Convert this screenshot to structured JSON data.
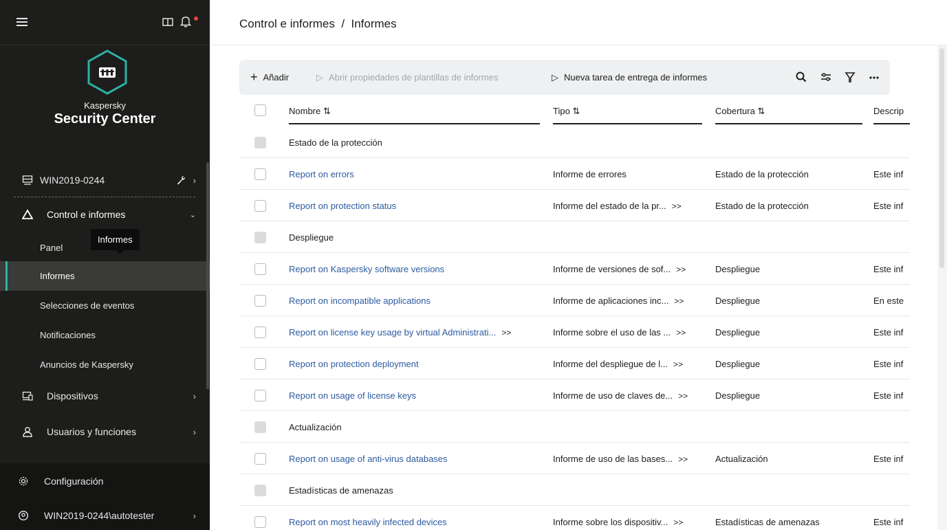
{
  "sidebar": {
    "brand_small": "Kaspersky",
    "brand_large": "Security Center",
    "server": "WIN2019-0244",
    "section": "Control e informes",
    "sub_items": [
      "Panel",
      "Informes",
      "Selecciones de eventos",
      "Notificaciones",
      "Anuncios de Kaspersky"
    ],
    "devices": "Dispositivos",
    "users": "Usuarios y funciones",
    "settings": "Configuración",
    "account": "WIN2019-0244\\autotester",
    "tooltip": "Informes",
    "accent": "#2cb3a6"
  },
  "header": {
    "breadcrumb": "Control e informes  /  Informes"
  },
  "toolbar": {
    "add": "Añadir",
    "open_props": "Abrir propiedades de plantillas de informes",
    "new_task": "Nueva tarea de entrega de informes"
  },
  "table": {
    "columns": [
      "Nombre ⇅",
      "Tipo ⇅",
      "Cobertura ⇅",
      "Descrip"
    ],
    "more": ">>",
    "rows": [
      {
        "group": true,
        "name": "Estado de la protección"
      },
      {
        "name": "Report on errors",
        "type": "Informe de errores",
        "coverage": "Estado de la protección",
        "desc": "Este inf"
      },
      {
        "name": "Report on protection status",
        "type": "Informe del estado de la pr...",
        "type_more": true,
        "coverage": "Estado de la protección",
        "desc": "Este inf"
      },
      {
        "group": true,
        "name": "Despliegue"
      },
      {
        "name": "Report on Kaspersky software versions",
        "type": "Informe de versiones de sof...",
        "type_more": true,
        "coverage": "Despliegue",
        "desc": "Este inf"
      },
      {
        "name": "Report on incompatible applications",
        "type": "Informe de aplicaciones inc...",
        "type_more": true,
        "coverage": "Despliegue",
        "desc": "En este"
      },
      {
        "name": "Report on license key usage by virtual Administrati...",
        "name_more": true,
        "type": "Informe sobre el uso de las ...",
        "type_more": true,
        "coverage": "Despliegue",
        "desc": "Este inf"
      },
      {
        "name": "Report on protection deployment",
        "type": "Informe del despliegue de l...",
        "type_more": true,
        "coverage": "Despliegue",
        "desc": "Este inf"
      },
      {
        "name": "Report on usage of license keys",
        "type": "Informe de uso de claves de...",
        "type_more": true,
        "coverage": "Despliegue",
        "desc": "Este inf"
      },
      {
        "group": true,
        "name": "Actualización"
      },
      {
        "name": "Report on usage of anti-virus databases",
        "type": "Informe de uso de las bases...",
        "type_more": true,
        "coverage": "Actualización",
        "desc": "Este inf"
      },
      {
        "group": true,
        "name": "Estadísticas de amenazas"
      },
      {
        "name": "Report on most heavily infected devices",
        "type": "Informe sobre los dispositiv...",
        "type_more": true,
        "coverage": "Estadísticas de amenazas",
        "desc": "Este inf"
      }
    ]
  }
}
